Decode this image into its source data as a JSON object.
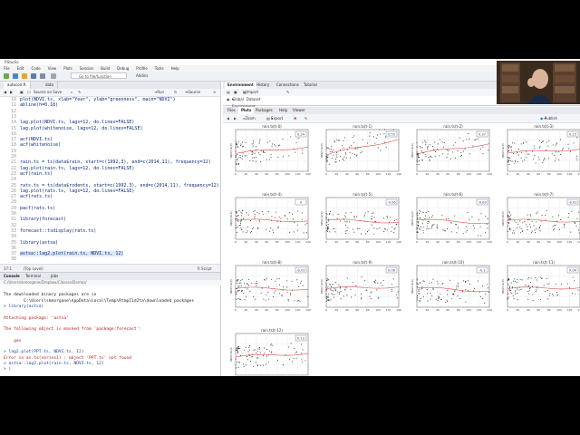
{
  "window": {
    "title": "RStudio",
    "menu": [
      "File",
      "Edit",
      "Code",
      "View",
      "Plots",
      "Session",
      "Build",
      "Debug",
      "Profile",
      "Tools",
      "Help"
    ],
    "goto_placeholder": "Go to file/function",
    "addins": "Addins"
  },
  "editor": {
    "tabs": [
      "autocorr.R",
      "data"
    ],
    "toolbar": {
      "source_on_save": "Source on Save",
      "run": "Run",
      "source": "Source"
    },
    "lines": [
      {
        "n": "10",
        "code": "plot(NDVI.ts, xlab=\"Year\", ylab=\"greenness\", main=\"NDVI\")"
      },
      {
        "n": "11",
        "code": "abline(h=0.18)"
      },
      {
        "n": "12",
        "code": ""
      },
      {
        "n": "13",
        "code": ""
      },
      {
        "n": "14",
        "code": "lag.plot(NDVI.ts, lags=12, do.lines=FALSE)"
      },
      {
        "n": "15",
        "code": "lag.plot(whitenoise, lags=12, do.lines=FALSE)"
      },
      {
        "n": "16",
        "code": ""
      },
      {
        "n": "17",
        "code": "acf(NDVI.ts)"
      },
      {
        "n": "18",
        "code": "acf(whitenoise)"
      },
      {
        "n": "19",
        "code": ""
      },
      {
        "n": "20",
        "code": ""
      },
      {
        "n": "21",
        "code": "rain.ts = ts(data$rain, start=c(1992,3), end=c(2014,11), frequency=12)"
      },
      {
        "n": "22",
        "code": "lag.plot(rain.ts, lags=12, do.lines=FALSE)"
      },
      {
        "n": "23",
        "code": "acf(rain.ts)"
      },
      {
        "n": "24",
        "code": ""
      },
      {
        "n": "25",
        "code": "rats.ts = ts(data$rodents, start=c(1992,3), end=c(2014,11), frequency=12)"
      },
      {
        "n": "26",
        "code": "lag.plot(rats.ts, lags=12, do.lines=FALSE)"
      },
      {
        "n": "27",
        "code": "acf(rats.ts)"
      },
      {
        "n": "28",
        "code": ""
      },
      {
        "n": "29",
        "code": "pacf(rats.ts)"
      },
      {
        "n": "30",
        "code": ""
      },
      {
        "n": "31",
        "code": "library(forecast)"
      },
      {
        "n": "32",
        "code": ""
      },
      {
        "n": "33",
        "code": "forecast::tsdisplay(rats.ts)"
      },
      {
        "n": "34",
        "code": ""
      },
      {
        "n": "35",
        "code": "library(astsa)"
      },
      {
        "n": "36",
        "code": ""
      },
      {
        "n": "37",
        "code": "astsa::lag2.plot(rain.ts, NDVI.ts, 12)"
      },
      {
        "n": "38",
        "code": ""
      }
    ],
    "status_pos": "37:1",
    "status_scope": "(Top Level)",
    "status_type": "R Script"
  },
  "console": {
    "tabs": [
      "Console",
      "Terminal",
      "Jobs"
    ],
    "path": "C:/Users/skmorgane/Dropbox/Classes/Demos/",
    "lines": [
      {
        "t": "out",
        "text": ""
      },
      {
        "t": "out",
        "text": "The downloaded binary packages are in"
      },
      {
        "t": "out",
        "text": "        C:\\Users\\skmorgane\\AppData\\Local\\Temp\\RtmpI1d2ta\\downloaded_packages"
      },
      {
        "t": "in",
        "text": "> library(astsa)"
      },
      {
        "t": "out",
        "text": ""
      },
      {
        "t": "msg",
        "text": "Attaching package: 'astsa'"
      },
      {
        "t": "out",
        "text": ""
      },
      {
        "t": "msg",
        "text": "The following object is masked from 'package:forecast':"
      },
      {
        "t": "out",
        "text": ""
      },
      {
        "t": "msg",
        "text": "    gas"
      },
      {
        "t": "out",
        "text": ""
      },
      {
        "t": "in",
        "text": "> lag2.plot(PPT.ts, NDVI.ts, 12)"
      },
      {
        "t": "msg",
        "text": "Error in as.ts(series1) : object 'PPT.ts' not found"
      },
      {
        "t": "in",
        "text": "> astsa::lag2.plot(rain.ts, NDVI.ts, 12)"
      },
      {
        "t": "in",
        "text": "> |"
      }
    ]
  },
  "environment": {
    "tabs": [
      "Environment",
      "History",
      "Connections",
      "Tutorial"
    ],
    "import_dataset": "Import Dataset",
    "scope": "Global Environment"
  },
  "plots": {
    "tabs": [
      "Files",
      "Plots",
      "Packages",
      "Help",
      "Viewer"
    ],
    "zoom": "Zoom",
    "export": "Export",
    "publish": "Publish",
    "ylabel": "NDVI.ts(0)",
    "xticks": [
      "0",
      "20",
      "40",
      "60",
      "80",
      "100",
      "120",
      "140"
    ],
    "yticks": [
      "0.10",
      "0.20",
      "0.30"
    ]
  },
  "chart_data": {
    "type": "scatter",
    "panels": [
      {
        "title": "rain.ts(t-0)",
        "cor": "0.24"
      },
      {
        "title": "rain.ts(t-1)",
        "cor": "0.55"
      },
      {
        "title": "rain.ts(t-2)",
        "cor": "0.37"
      },
      {
        "title": "rain.ts(t-3)",
        "cor": "0.15"
      },
      {
        "title": "rain.ts(t-4)",
        "cor": "0"
      },
      {
        "title": "rain.ts(t-5)",
        "cor": "-0.06"
      },
      {
        "title": "rain.ts(t-6)",
        "cor": "-0.09"
      },
      {
        "title": "rain.ts(t-7)",
        "cor": "-0.02"
      },
      {
        "title": "rain.ts(t-8)",
        "cor": "-0.02"
      },
      {
        "title": "rain.ts(t-9)",
        "cor": "0.08"
      },
      {
        "title": "rain.ts(t-10)",
        "cor": "-0.1"
      },
      {
        "title": "rain.ts(t-11)",
        "cor": "0.04"
      },
      {
        "title": "rain.ts(t-12)",
        "cor": "0.13"
      }
    ],
    "xlim": [
      0,
      140
    ],
    "ylim": [
      0.05,
      0.35
    ],
    "point_color": "#333333",
    "smooth_color": "#d9534f"
  }
}
